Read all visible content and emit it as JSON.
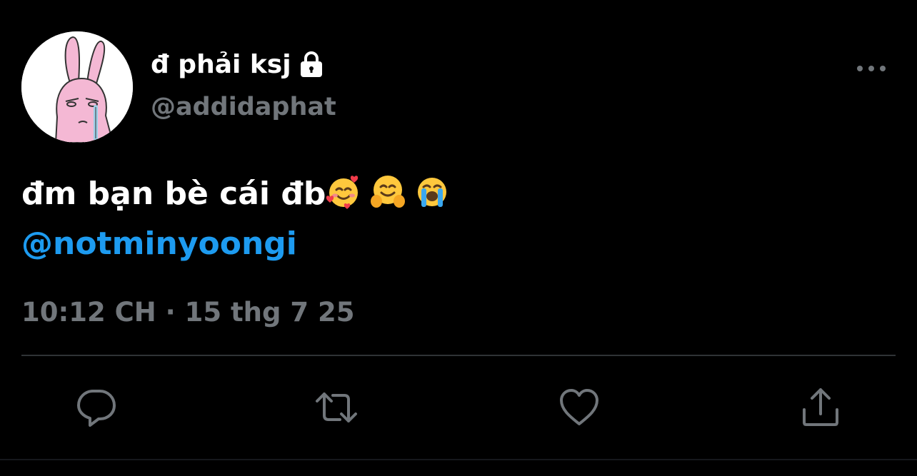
{
  "tweet": {
    "author": {
      "display_name": "đ phải ksj",
      "handle": "@addidaphat",
      "avatar_icon": "pink-rabbit-avatar",
      "protected_icon": "lock-icon"
    },
    "more_icon": "more-options-icon",
    "text": "đm bạn bè cái đb",
    "emojis": [
      "smiling-face-with-hearts",
      "hugging-face",
      "loudly-crying-face"
    ],
    "mention": "@notminyoongi",
    "timestamp": "10:12 CH · 15 thg 7 25"
  },
  "actions": [
    {
      "name": "reply",
      "icon": "reply-icon"
    },
    {
      "name": "retweet",
      "icon": "retweet-icon"
    },
    {
      "name": "like",
      "icon": "heart-icon"
    },
    {
      "name": "share",
      "icon": "share-icon"
    }
  ],
  "colors": {
    "background": "#000000",
    "primary_text": "#ffffff",
    "secondary_text": "#71767b",
    "link": "#1d9bf0",
    "divider": "#2f3336"
  }
}
